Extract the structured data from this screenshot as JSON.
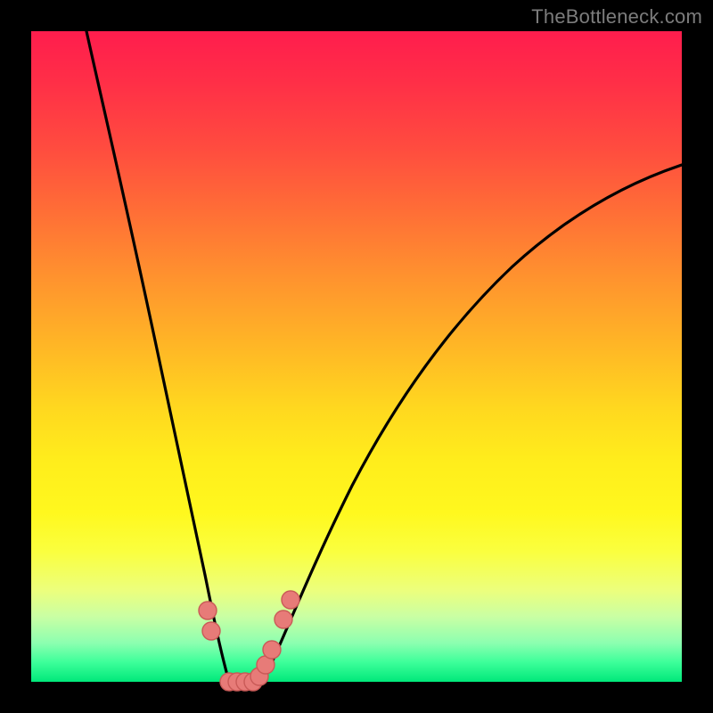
{
  "watermark": "TheBottleneck.com",
  "colors": {
    "frame": "#000000",
    "curve": "#000000",
    "marker_fill": "#e77b78",
    "marker_stroke": "#c95a57"
  },
  "chart_data": {
    "type": "line",
    "title": "",
    "xlabel": "",
    "ylabel": "",
    "xlim": [
      0,
      100
    ],
    "ylim": [
      0,
      100
    ],
    "grid": false,
    "legend": false,
    "series": [
      {
        "name": "bottleneck-curve-left",
        "x": [
          8.5,
          12,
          16,
          20,
          23,
          25,
          26.5,
          27.8,
          28.8,
          29.6,
          30.4
        ],
        "y": [
          100,
          85,
          67,
          48,
          33,
          22,
          14,
          8,
          4,
          1.5,
          0
        ]
      },
      {
        "name": "bottleneck-curve-right",
        "x": [
          35.6,
          38,
          42,
          48,
          55,
          63,
          72,
          82,
          92,
          100
        ],
        "y": [
          0,
          4,
          12,
          24,
          36,
          48,
          58,
          67,
          74,
          79
        ]
      },
      {
        "name": "valley-floor",
        "x": [
          30.4,
          31.2,
          32.4,
          33.6,
          34.8,
          35.6
        ],
        "y": [
          0,
          0,
          0,
          0,
          0,
          0
        ]
      }
    ],
    "markers": [
      {
        "x": 27.1,
        "y": 11.0
      },
      {
        "x": 27.7,
        "y": 7.8
      },
      {
        "x": 30.4,
        "y": 0.0
      },
      {
        "x": 31.6,
        "y": 0.0
      },
      {
        "x": 32.9,
        "y": 0.0
      },
      {
        "x": 34.1,
        "y": 0.0
      },
      {
        "x": 35.0,
        "y": 0.8
      },
      {
        "x": 36.0,
        "y": 2.6
      },
      {
        "x": 37.0,
        "y": 5.0
      },
      {
        "x": 38.7,
        "y": 9.6
      },
      {
        "x": 39.9,
        "y": 12.6
      }
    ]
  }
}
